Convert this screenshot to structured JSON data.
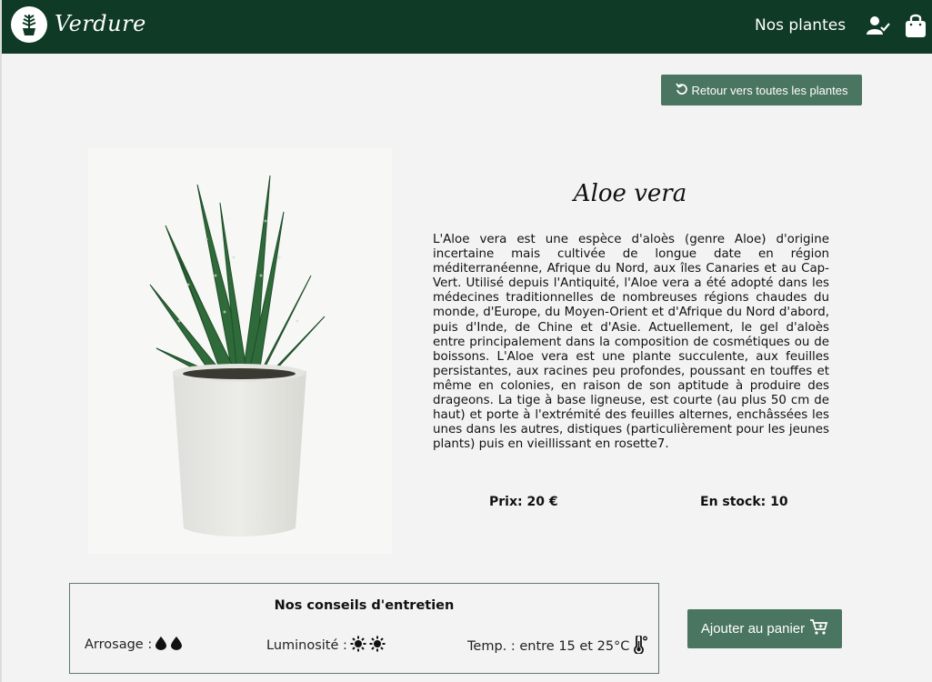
{
  "header": {
    "brand": "Verdure",
    "nav_link": "Nos plantes",
    "icons": [
      "plant-logo-icon",
      "user-check-icon",
      "shopping-bag-icon"
    ]
  },
  "actions": {
    "back_label": "Retour vers toutes les plantes",
    "add_to_cart_label": "Ajouter au panier"
  },
  "plant": {
    "name": "Aloe vera",
    "description": "L'Aloe vera est une espèce d'aloès (genre Aloe) d'origine incertaine mais cultivée de longue date en région méditerranéenne, Afrique du Nord, aux îles Canaries et au Cap-Vert. Utilisé depuis l'Antiquité, l'Aloe vera a été adopté dans les médecines traditionnelles de nombreuses régions chaudes du monde, d'Europe, du Moyen-Orient et d'Afrique du Nord d'abord, puis d'Inde, de Chine et d'Asie. Actuellement, le gel d'aloès entre principalement dans la composition de cosmétiques ou de boissons. L'Aloe vera est une plante succulente, aux feuilles persistantes, aux racines peu profondes, poussant en touffes et même en colonies, en raison de son aptitude à produire des drageons. La tige à base ligneuse, est courte (au plus 50 cm de haut) et porte à l'extrémité des feuilles alternes, enchâssées les unes dans les autres, distiques (particulièrement pour les jeunes plants) puis en vieillissant en rosette7.",
    "price_label": "Prix: 20 €",
    "stock_label": "En stock: 10"
  },
  "care": {
    "title": "Nos conseils d'entretien",
    "watering_label": "Arrosage :",
    "watering_level": 2,
    "light_label": "Luminosité :",
    "light_level": 2,
    "temp_label": "Temp. : entre 15 et 25°C"
  },
  "colors": {
    "header_bg": "#0e3a26",
    "button_bg": "#4a7560",
    "page_bg": "#f3f3f3"
  }
}
